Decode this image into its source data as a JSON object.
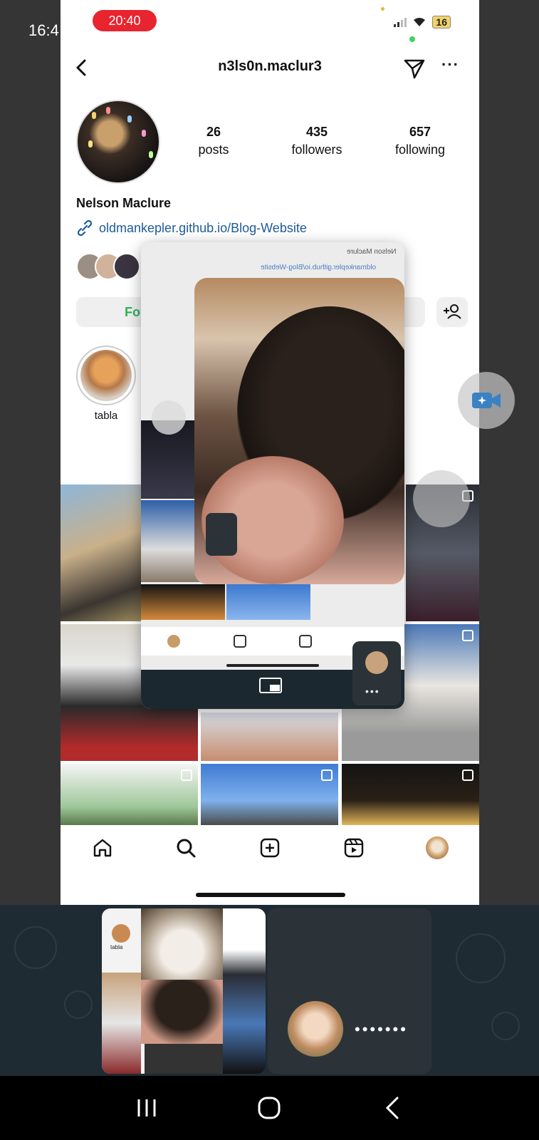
{
  "background_clock": "16:4",
  "status_bar": {
    "recording_time": "20:40",
    "battery": "16"
  },
  "header": {
    "username": "n3ls0n.maclur3"
  },
  "profile": {
    "stats": [
      {
        "num": "26",
        "label": "posts"
      },
      {
        "num": "435",
        "label": "followers"
      },
      {
        "num": "657",
        "label": "following"
      }
    ],
    "full_name": "Nelson Maclure",
    "link": "oldmankepler.github.io/Blog-Website",
    "follow_label": "Fo"
  },
  "highlights": [
    {
      "label": "tabla"
    }
  ],
  "overlay": {
    "mirrored_name": "Nelson Maclure",
    "mirrored_link": "oldmankepler.github.io/Blog-Website"
  },
  "recents": {
    "thumb_label": "tabla",
    "call_dots": "•••••••"
  },
  "colors": {
    "accent_green": "#2bb35a",
    "link_blue": "#1d5b9c",
    "record_red": "#e8242f"
  },
  "icons": [
    "back-icon",
    "send-icon",
    "more-icon",
    "link-icon",
    "add-user-icon",
    "home-icon",
    "search-icon",
    "create-icon",
    "reels-icon",
    "video-call-icon",
    "recents-nav-icon",
    "home-nav-icon",
    "back-nav-icon"
  ]
}
